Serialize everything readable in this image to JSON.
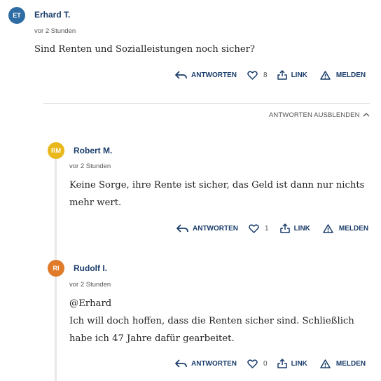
{
  "comments": [
    {
      "initials": "ET",
      "avatar_color": "#2e6da4",
      "author": "Erhard T.",
      "time": "vor 2 Stunden",
      "lines": [
        "Sind Renten und Sozialleistungen noch sicher?"
      ],
      "likes": "8"
    },
    {
      "initials": "RM",
      "avatar_color": "#e8b81c",
      "author": "Robert M.",
      "time": "vor 2 Stunden",
      "lines": [
        "Keine Sorge, ihre Rente ist sicher, das Geld ist dann nur nichts",
        "mehr wert."
      ],
      "likes": "1"
    },
    {
      "initials": "RI",
      "avatar_color": "#e07b2a",
      "author": "Rudolf I.",
      "time": "vor 2 Stunden",
      "lines": [
        "@Erhard",
        "Ich will doch hoffen, dass die Renten sicher sind. Schließlich",
        "habe ich 47 Jahre dafür gearbeitet."
      ],
      "likes": "0"
    }
  ],
  "actions": {
    "reply": "ANTWORTEN",
    "link": "LINK",
    "report": "MELDEN"
  },
  "hide_replies": "ANTWORTEN AUSBLENDEN"
}
